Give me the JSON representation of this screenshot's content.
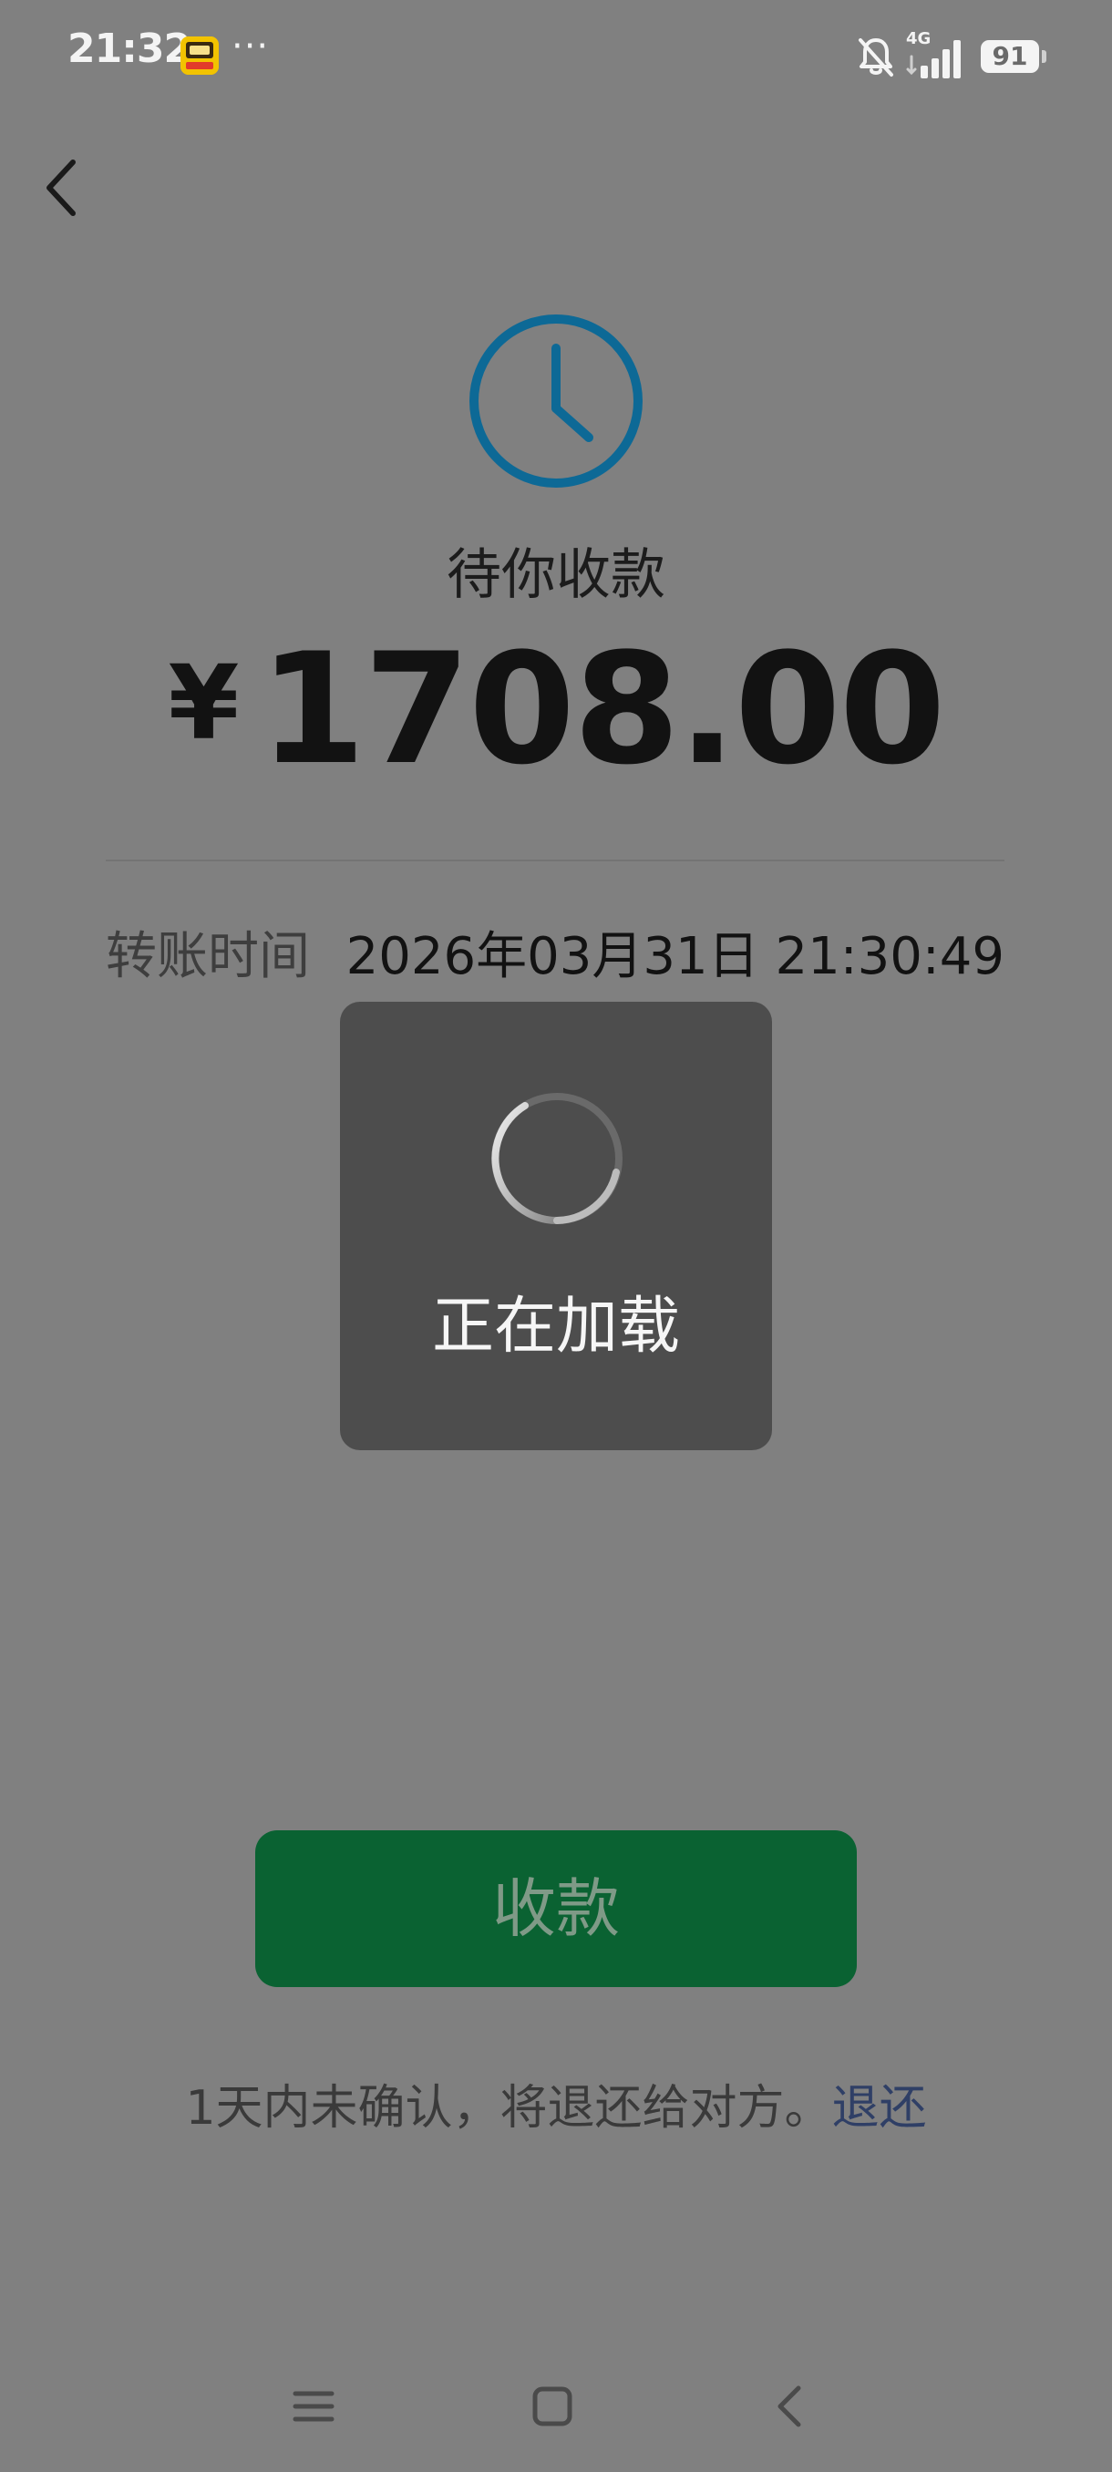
{
  "status_bar": {
    "time": "21:32",
    "app_icon": "app-notification-icon",
    "dots": "···",
    "network": "4G",
    "battery": "91",
    "icons": [
      "bell-muted-icon",
      "signal-icon",
      "battery-icon"
    ]
  },
  "nav": {
    "back_icon": "chevron-left-icon"
  },
  "transfer": {
    "status_icon": "clock-icon",
    "status_title": "待你收款",
    "currency": "¥",
    "amount": "1708.00",
    "time_label": "转账时间",
    "time_value": "2026年03月31日 21:30:49"
  },
  "loading": {
    "text": "正在加载",
    "icon": "spinner-icon"
  },
  "actions": {
    "receive_label": "收款"
  },
  "footer": {
    "note": "1天内未确认，将退还给对方。",
    "refund_link": "退还"
  },
  "system_nav": {
    "items": [
      "menu-icon",
      "home-icon",
      "back-icon"
    ]
  },
  "colors": {
    "overlay_background": "#808080",
    "accent_blue": "#0d6996",
    "button_green": "#0a6232",
    "link_blue": "#2f3f66",
    "toast_background": "#4d4d4d"
  }
}
